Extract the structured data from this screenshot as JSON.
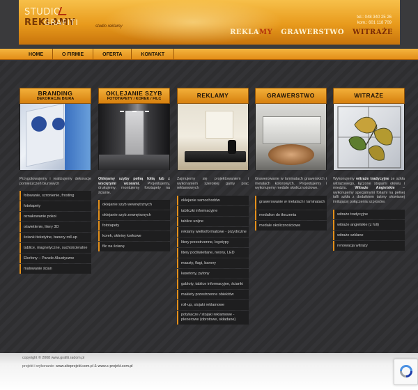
{
  "header": {
    "logo_studio": "STUDIO",
    "logo_reklamy": "REKLAMY",
    "logo_grafiti": "GRAFITI",
    "tagline": "studio reklamy",
    "contact": [
      "tel.: 048 340 25 26",
      "kom.: 601 118 709"
    ],
    "links": {
      "reklamy_a": "REKLA",
      "reklamy_b": "MY",
      "grawerstwo": "GRAWERSTWO",
      "witraze": "WITRAŻE"
    }
  },
  "nav": [
    "HOME",
    "O FIRMIE",
    "OFERTA",
    "KONTAKT"
  ],
  "columns": [
    {
      "title": "BRANDING",
      "subtitle": "DEKORACJE BIURA",
      "desc_plain": "Przygotowujemy i realizujemy dekoracje pomieszczeń biurowych",
      "items": [
        "folowanie, szronienie, frosting",
        "fototapety",
        "oznakowanie pokoi",
        "oświetlenie, litery 3D",
        "ścianki tekstylne, banery roll-up",
        "tablice, magnetyczne, suchościeralne",
        "Ekofony – Panele Akustyczne",
        "malowanie ścian"
      ]
    },
    {
      "title": "OKLEJANIE SZYB",
      "subtitle": "FOTOTAPETY / KOREK / FILC",
      "desc_bold": "Oklejamy szyby pełną folią lub z wyciętymi wzorami.",
      "desc_plain": "Projektujemy, drukujemy, montujemy fototapety na ścianie.",
      "items": [
        "oklejanie szyb wewnętrznych",
        "oklejanie szyb zewnętrznych",
        "fototapety",
        "korek, okleiny korkowe",
        "filc na ścianę"
      ]
    },
    {
      "title": "REKLAMY",
      "desc_plain": "Zajmujemy się projektowaniem i wykonaniem szerokiej gamy prac reklamowych",
      "items": [
        "oklejanie samochodów",
        "tabliczki informacyjne",
        "tablice unijne",
        "reklamy wielkoformatowe - przydrożne",
        "litery przestrzenne, logotypy",
        "litery podświetlane, neony, LED",
        "maszty, flagi, banery",
        "kasetony, pylony",
        "gabloty, tablice informacyjne, ścianki",
        "makiety przestrzenne obiektów",
        "roll-up, stojaki reklamowe",
        "potykacze / stojaki reklamowe - plenerowe (obrotowe, składane)"
      ]
    },
    {
      "title": "GRAWERSTWO",
      "desc_plain": "Grawerowanie w laminatach grawerskich i metalach kolorowych. Projektujemy i wykonujemy medale okolicznościowe.",
      "items": [
        "grawerowanie w metalach i laminatach",
        "medalion do tłoczenia",
        "medale okolicznościowe"
      ]
    },
    {
      "title": "WITRAŻE",
      "desc_pre": "Wykonujemy ",
      "desc_bold": "witraże tradycyjne",
      "desc_mid": " ze szkła witrażowego, łączone stopami ołowiu i miedziu.",
      "desc_bold2": "Witraże Angielskie",
      "desc_post": " – wykonujemy specjalnymi foliami na pełnej tafli szkła z dodatkiem taśmy ołowianej imitującej połączenia szprosów.",
      "items": [
        "witraże tradycyjne",
        "witraże angielskie (z foli)",
        "witraże szklane",
        "renowacja witraży"
      ]
    }
  ],
  "footer": {
    "copyright": "copyright © 2008 www.grafiti.radom.pl",
    "credits_label": "projekt i wykonanie:",
    "credits_link1": "www.siteprojekt.com.pl",
    "credits_sep": "&",
    "credits_link2": "www.s-projekt.com.pl"
  },
  "colors": {
    "accent": "#e5901a",
    "header": "#f3b03a",
    "background": "#2e2e30"
  }
}
